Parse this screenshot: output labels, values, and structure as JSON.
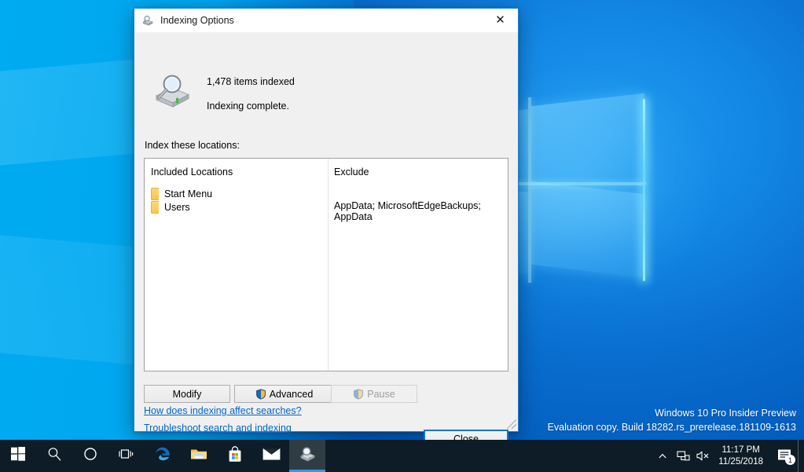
{
  "desktop": {
    "watermark": {
      "line1": "Windows 10 Pro Insider Preview",
      "line2": "Evaluation copy. Build 18282.rs_prerelease.181109-1613"
    },
    "wallpaper_colors": {
      "left": "#00a8ee",
      "right": "#0052b4",
      "glow": "#5ac8ff"
    }
  },
  "dialog": {
    "title": "Indexing Options",
    "title_icon": "indexing-options-icon",
    "close_label": "✕",
    "accent": "#1883d7",
    "background": "#f0f0f0",
    "status": {
      "items_indexed": "1,478 items indexed",
      "state": "Indexing complete.",
      "icon": "search-drive-icon"
    },
    "locations_label": "Index these locations:",
    "list": {
      "columns": [
        "Included Locations",
        "Exclude"
      ],
      "rows": [
        {
          "location": "Start Menu",
          "icon": "folder-icon",
          "exclude": ""
        },
        {
          "location": "Users",
          "icon": "folder-icon",
          "exclude": "AppData; MicrosoftEdgeBackups; AppData"
        }
      ]
    },
    "buttons": {
      "modify": "Modify",
      "advanced": "Advanced",
      "advanced_icon": "uac-shield-icon",
      "pause": "Pause",
      "pause_icon": "uac-shield-icon",
      "pause_disabled": true,
      "close": "Close"
    },
    "links": [
      "How does indexing affect searches?",
      "Troubleshoot search and indexing"
    ]
  },
  "taskbar": {
    "background": "#0d1c26",
    "items": [
      {
        "name": "start-button",
        "icon": "windows-logo-icon"
      },
      {
        "name": "search-button",
        "icon": "search-icon"
      },
      {
        "name": "cortana-button",
        "icon": "cortana-circle-icon"
      },
      {
        "name": "task-view-button",
        "icon": "task-view-icon"
      },
      {
        "name": "edge-button",
        "icon": "edge-icon"
      },
      {
        "name": "file-explorer-button",
        "icon": "folder-icon"
      },
      {
        "name": "microsoft-store-button",
        "icon": "store-bag-icon"
      },
      {
        "name": "mail-button",
        "icon": "mail-envelope-icon"
      },
      {
        "name": "indexing-options-button",
        "icon": "indexing-options-icon",
        "active": true
      }
    ],
    "tray": {
      "chevron": "show-hidden-icons",
      "network": "network-icon",
      "volume": "volume-muted-icon",
      "time": "11:17 PM",
      "date": "11/25/2018",
      "action_center_icon": "action-center-icon",
      "action_center_badge": "1"
    }
  }
}
